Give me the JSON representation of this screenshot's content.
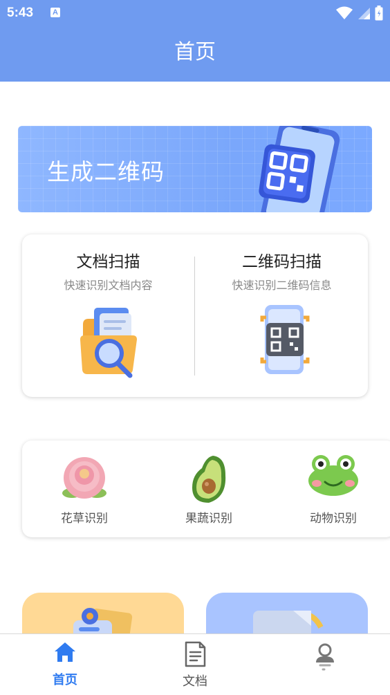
{
  "status_bar": {
    "time": "5:43",
    "notification_icon": "A"
  },
  "app_bar": {
    "title": "首页"
  },
  "banner": {
    "label": "生成二维码"
  },
  "scan": {
    "document": {
      "title": "文档扫描",
      "subtitle": "快速识别文档内容"
    },
    "qrcode": {
      "title": "二维码扫描",
      "subtitle": "快速识别二维码信息"
    }
  },
  "recognize": {
    "items": [
      {
        "label": "花草识别",
        "icon": "flower-icon"
      },
      {
        "label": "果蔬识别",
        "icon": "avocado-icon"
      },
      {
        "label": "动物识别",
        "icon": "frog-icon"
      }
    ]
  },
  "bottom_nav": {
    "items": [
      {
        "label": "首页",
        "icon": "home-icon",
        "active": true
      },
      {
        "label": "文档",
        "icon": "document-icon",
        "active": false
      },
      {
        "label": "",
        "icon": "user-icon",
        "active": false
      }
    ]
  },
  "colors": {
    "primary": "#6f9bf0",
    "nav_active": "#2f7bf0"
  }
}
